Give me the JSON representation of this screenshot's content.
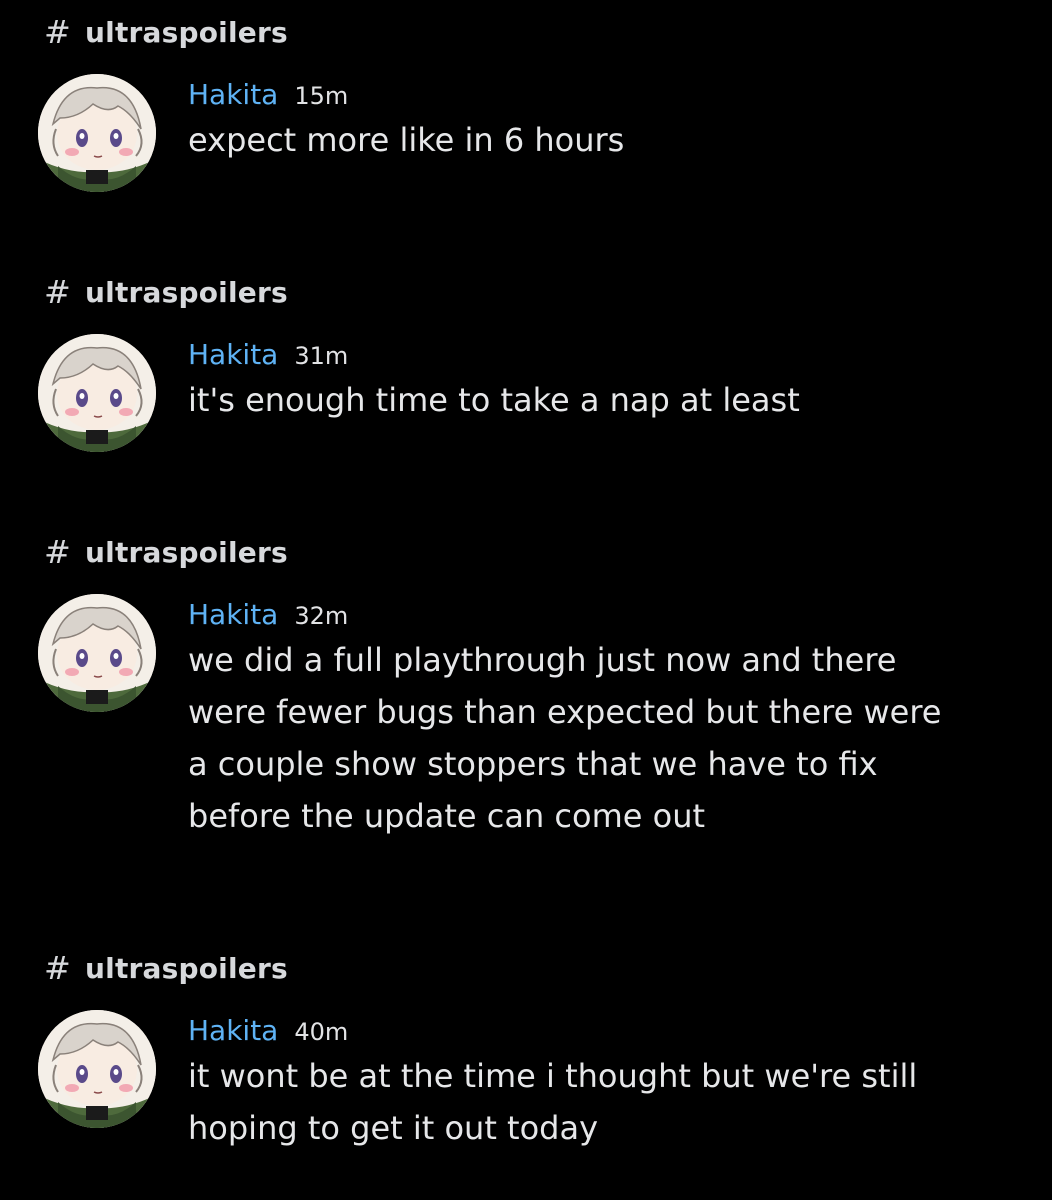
{
  "messages": [
    {
      "channel": "ultraspoilers",
      "username": "Hakita",
      "time": "15m",
      "lines": [
        "expect more like in 6 hours"
      ]
    },
    {
      "channel": "ultraspoilers",
      "username": "Hakita",
      "time": "31m",
      "lines": [
        "it's enough time to take a nap at least"
      ]
    },
    {
      "channel": "ultraspoilers",
      "username": "Hakita",
      "time": "32m",
      "lines": [
        "we did a full playthrough just now and there",
        "were fewer bugs than expected but there were",
        "a couple show stoppers that we have to fix",
        "before the update can come out"
      ]
    },
    {
      "channel": "ultraspoilers",
      "username": "Hakita",
      "time": "40m",
      "lines": [
        "it wont be at the time i thought but we're still",
        "hoping to get it out today"
      ]
    }
  ],
  "colors": {
    "background": "#000000",
    "username": "#5fb3f5",
    "text": "#e6e7e9",
    "channel": "#d7d9dc"
  },
  "icons": {
    "channel_icon": "hash-icon",
    "avatar": "anime-avatar"
  }
}
